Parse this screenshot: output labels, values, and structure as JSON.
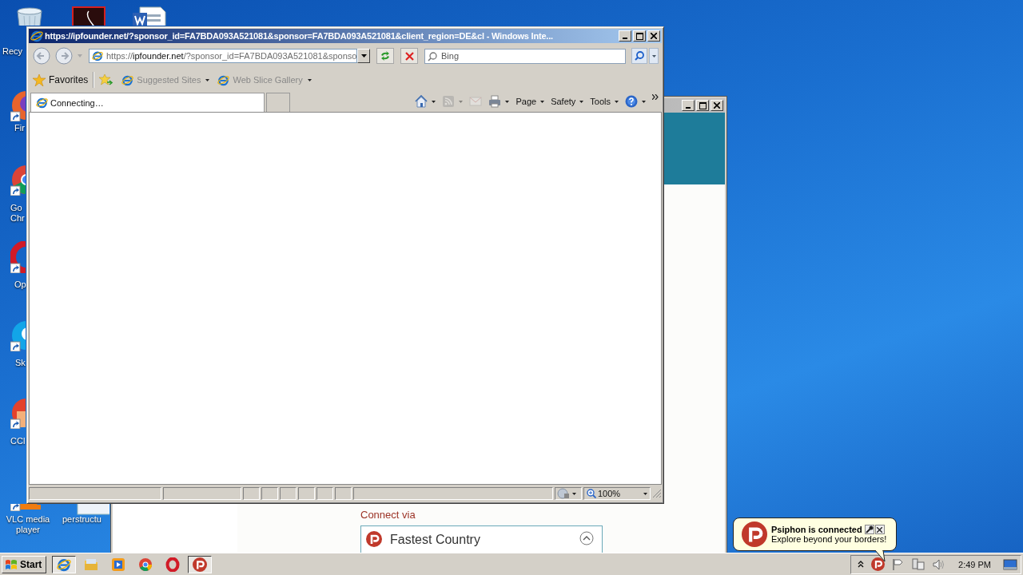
{
  "desktop": {
    "icons": [
      {
        "kind": "recycle-bin",
        "label": "Recy"
      },
      {
        "kind": "pdf"
      },
      {
        "kind": "word"
      },
      {
        "kind": "firefox",
        "label": "Fir"
      },
      {
        "kind": "chrome",
        "label": "Go Chr"
      },
      {
        "kind": "opera",
        "label": "Op"
      },
      {
        "kind": "skype",
        "label": "Sk"
      },
      {
        "kind": "ccleaner",
        "label": "CCl"
      },
      {
        "kind": "vlc",
        "label": "VLC media player"
      },
      {
        "kind": "document",
        "label": "perstructu"
      }
    ]
  },
  "back_window": {
    "connect_label": "Connect via",
    "server": "Fastest Country"
  },
  "browser": {
    "title": "https://ipfounder.net/?sponsor_id=FA7BDA093A521081&sponsor=FA7BDA093A521081&client_region=DE&cl - Windows Inte...",
    "url": {
      "scheme": "https://",
      "host": "ipfounder.net",
      "path": "/?sponsor_id=FA7BDA093A521081&sponso"
    },
    "search": {
      "placeholder": "Bing"
    },
    "favorites_bar": {
      "label": "Favorites",
      "links": [
        {
          "label": "Suggested Sites",
          "disabled": true
        },
        {
          "label": "Web Slice Gallery",
          "disabled": true
        }
      ]
    },
    "tabs": [
      {
        "label": "Connecting…",
        "selected": true
      }
    ],
    "commands": [
      {
        "kind": "home",
        "menu": true,
        "disabled": false
      },
      {
        "kind": "feeds",
        "menu": true,
        "disabled": true
      },
      {
        "kind": "mail",
        "menu": false,
        "disabled": true
      },
      {
        "kind": "print",
        "menu": true,
        "disabled": false
      },
      {
        "kind": "text",
        "label": "Page",
        "menu": true,
        "disabled": false
      },
      {
        "kind": "text",
        "label": "Safety",
        "menu": true,
        "disabled": false
      },
      {
        "kind": "text",
        "label": "Tools",
        "menu": true,
        "disabled": false
      },
      {
        "kind": "help",
        "menu": true,
        "disabled": false
      }
    ],
    "status_bar": {
      "zoom": "100%"
    }
  },
  "notification": {
    "title": "Psiphon is connected",
    "message": "Explore beyond your borders!"
  },
  "taskbar": {
    "start": "Start",
    "apps": [
      {
        "kind": "ie",
        "selected": true
      },
      {
        "kind": "explorer",
        "selected": false
      },
      {
        "kind": "media",
        "selected": false
      },
      {
        "kind": "chrome",
        "selected": false
      },
      {
        "kind": "opera",
        "selected": false
      },
      {
        "kind": "psiphon",
        "selected": true
      }
    ],
    "tray": {
      "time": "2:49 PM"
    }
  }
}
